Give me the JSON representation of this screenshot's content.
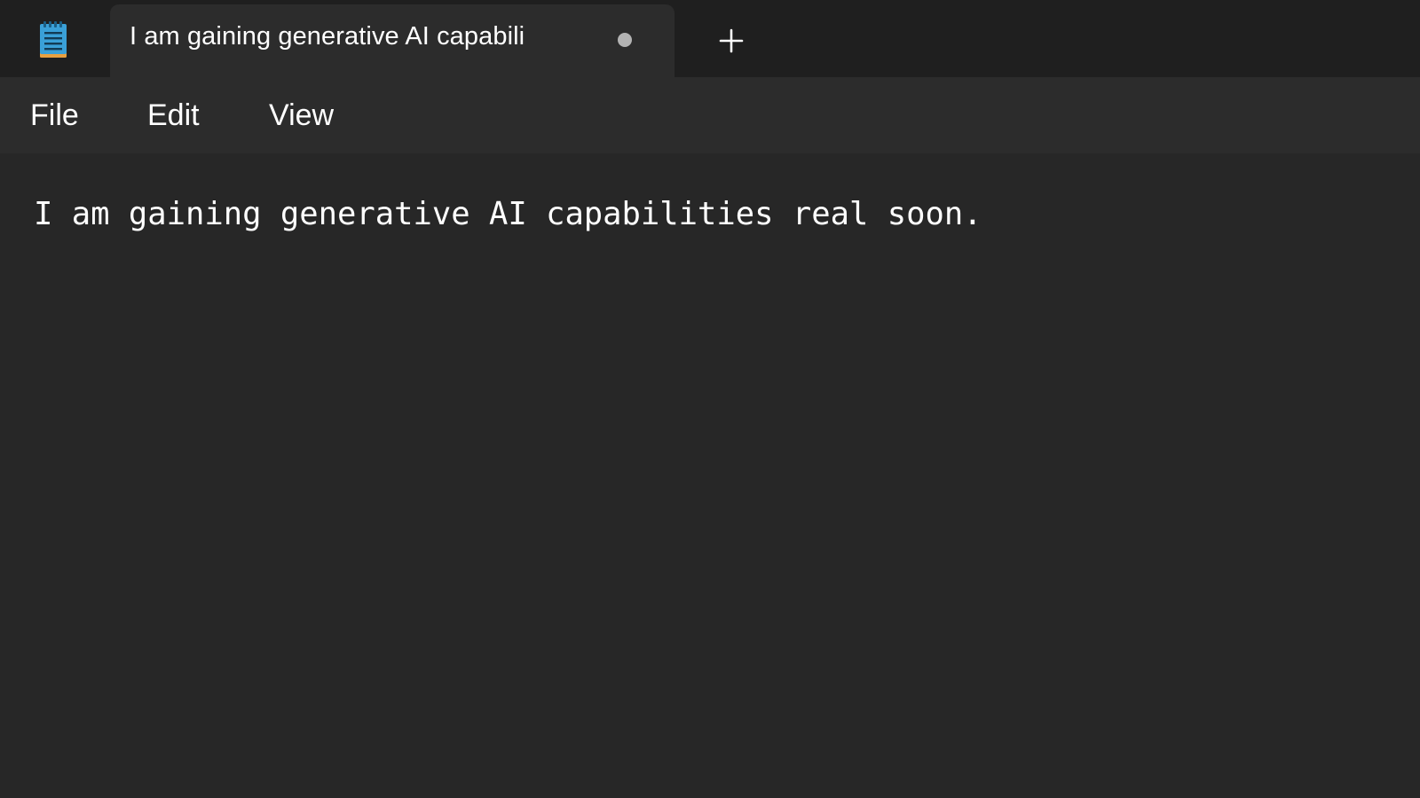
{
  "titlebar": {
    "app_icon": "notepad-icon",
    "tab": {
      "title": "I am gaining generative AI capabili",
      "unsaved_indicator": "dot"
    },
    "new_tab_icon": "plus-icon"
  },
  "menubar": {
    "items": [
      {
        "label": "File"
      },
      {
        "label": "Edit"
      },
      {
        "label": "View"
      }
    ]
  },
  "editor": {
    "content": "I am gaining generative AI capabilities real soon."
  },
  "colors": {
    "titlebar_bg": "#1f1f1f",
    "tab_bg": "#2c2c2c",
    "menubar_bg": "#2c2c2c",
    "editor_bg": "#272727",
    "text": "#ffffff",
    "dirty_dot": "#b3b3b3",
    "icon_blue": "#3aa0d8",
    "icon_orange": "#e8a040"
  }
}
